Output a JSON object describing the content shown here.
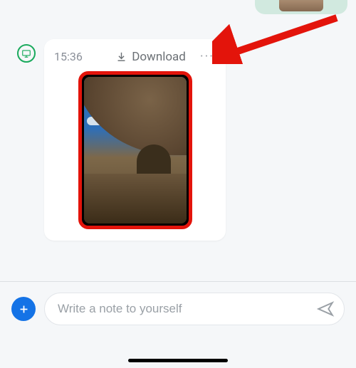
{
  "previous_message": {
    "type": "image-thumbnail"
  },
  "source_indicator": {
    "icon": "desktop-icon",
    "color": "#1aaa5d"
  },
  "message": {
    "timestamp": "15:36",
    "download_label": "Download",
    "more_label": "···",
    "image": {
      "highlight_color": "#e3140b",
      "description": "stone-arch-blue-sky"
    }
  },
  "annotation": {
    "arrow_color": "#e3140b"
  },
  "composer": {
    "placeholder": "Write a note to yourself",
    "add_icon": "plus-icon",
    "send_icon": "send-icon"
  }
}
